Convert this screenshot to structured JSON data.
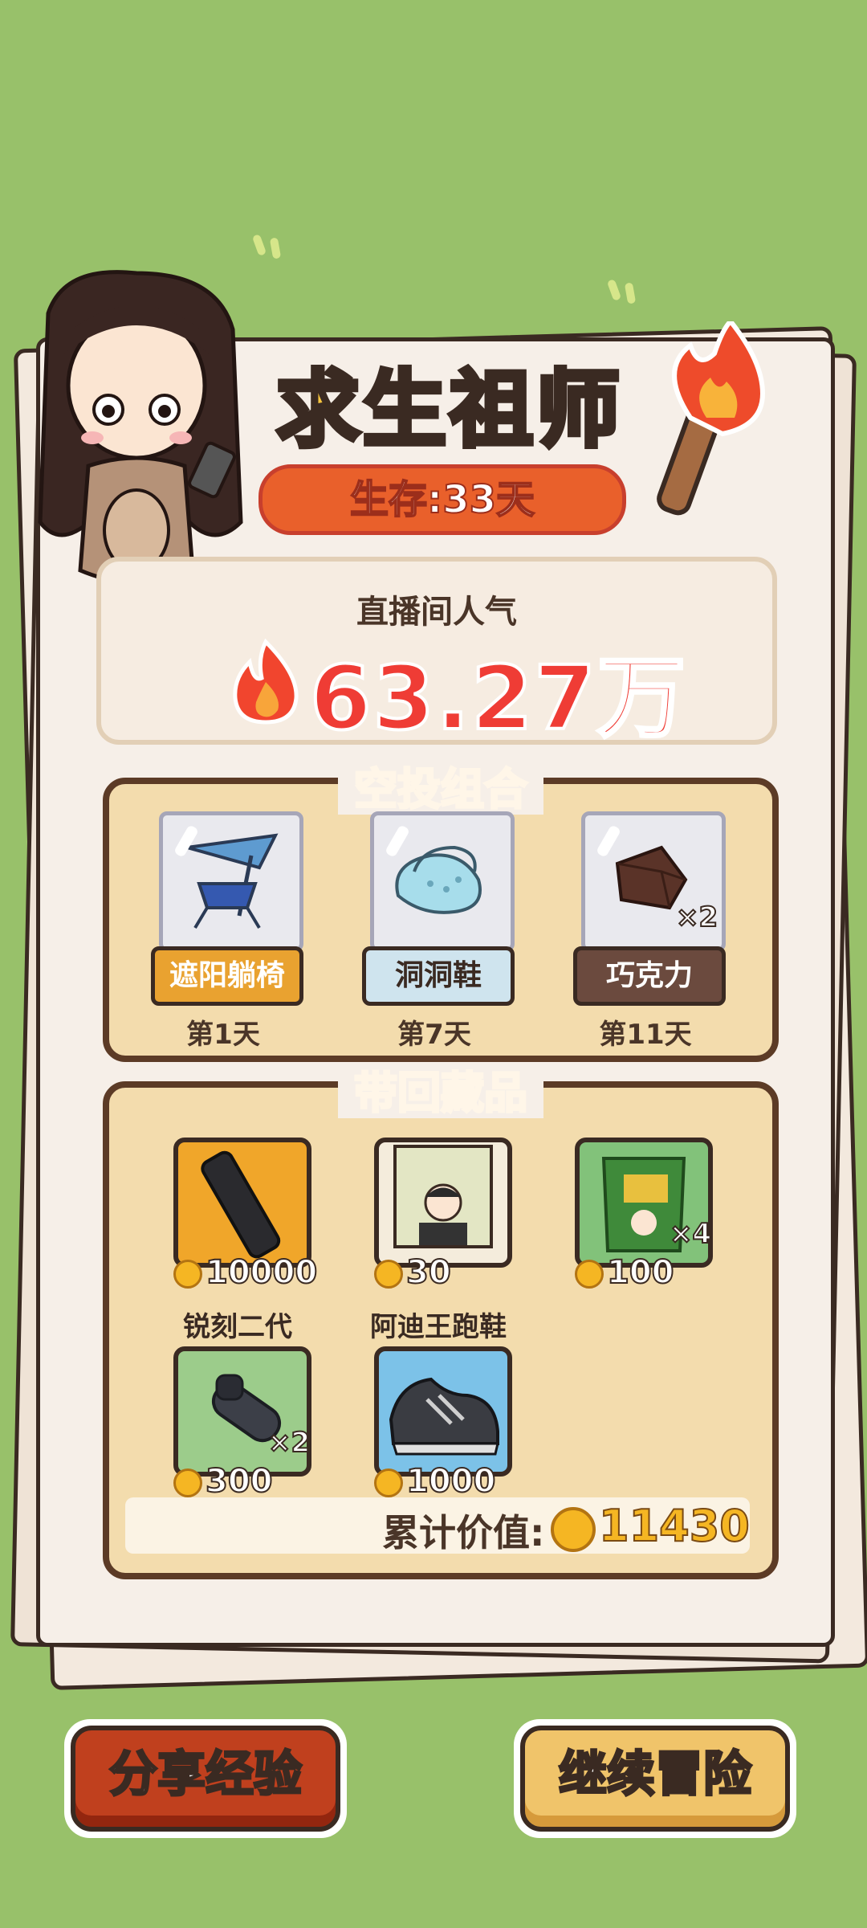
{
  "title": "求生祖师",
  "survival": "生存:33天",
  "popularity": {
    "label": "直播间人气",
    "value": "63.27万"
  },
  "airdrop": {
    "title": "空投组合",
    "items": [
      {
        "name": "遮阳躺椅",
        "day": "第1天",
        "count": "",
        "label_color": "#e9a230"
      },
      {
        "name": "洞洞鞋",
        "day": "第7天",
        "count": "",
        "label_color": "#cfe4ee"
      },
      {
        "name": "巧克力",
        "day": "第11天",
        "count": "×2",
        "label_color": "#6b4a3e"
      }
    ]
  },
  "collection": {
    "title": "带回藏品",
    "items": [
      {
        "name": "",
        "price": "10000",
        "count": "",
        "frame_color": "#f0a62a"
      },
      {
        "name": "",
        "price": "30",
        "count": "",
        "frame_color": "#f4ecdc"
      },
      {
        "name": "",
        "price": "100",
        "count": "×4",
        "frame_color": "#82c27a"
      },
      {
        "name": "锐刻二代",
        "price": "300",
        "count": "×2",
        "frame_color": "#9ccc8b"
      },
      {
        "name": "阿迪王跑鞋",
        "price": "1000",
        "count": "",
        "frame_color": "#7cc2e8"
      }
    ],
    "total_label": "累计价值:",
    "total_value": "11430"
  },
  "buttons": {
    "share": "分享经验",
    "continue": "继续冒险"
  },
  "colors": {
    "background": "#98c16a",
    "title": "#f8c63f",
    "survival_pill": "#e9602b",
    "popularity_value": "#ef3c35",
    "share_button": "#c0401e",
    "continue_button": "#f0c46a"
  }
}
